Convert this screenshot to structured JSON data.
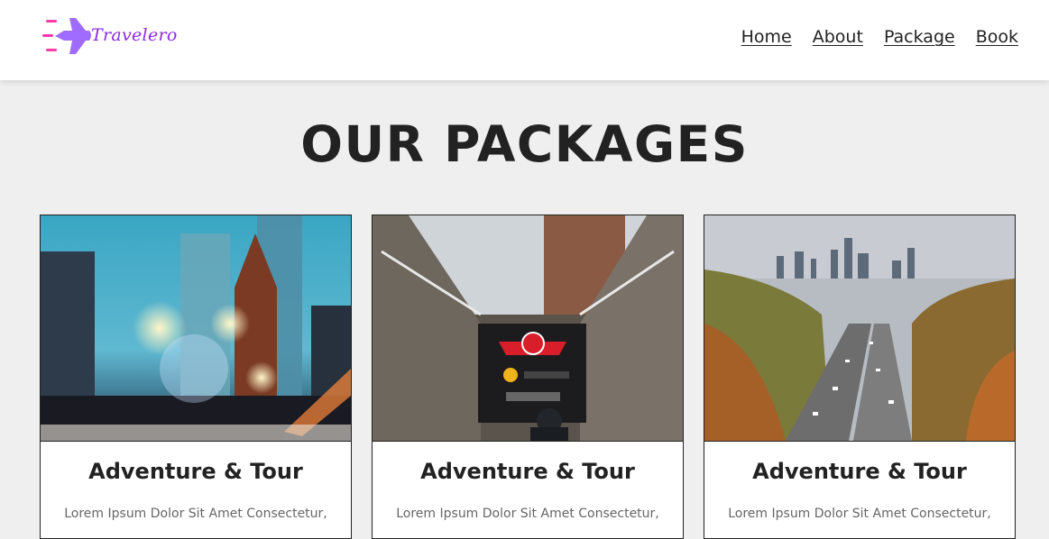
{
  "brand": {
    "name": "Travelero",
    "accent": "#8a2be2",
    "plane_color": "#a06bff",
    "stripe_color": "#ff3aa8"
  },
  "nav": {
    "items": [
      {
        "label": "Home"
      },
      {
        "label": "About"
      },
      {
        "label": "Package"
      },
      {
        "label": "Book"
      }
    ]
  },
  "main": {
    "title": "OUR PACKAGES",
    "cards": [
      {
        "image": "city-night-street-photo",
        "title": "Adventure & Tour",
        "text": "Lorem Ipsum Dolor Sit Amet Consectetur,"
      },
      {
        "image": "subway-entrance-photo",
        "title": "Adventure & Tour",
        "text": "Lorem Ipsum Dolor Sit Amet Consectetur,"
      },
      {
        "image": "highway-valley-skyline-photo",
        "title": "Adventure & Tour",
        "text": "Lorem Ipsum Dolor Sit Amet Consectetur,"
      }
    ]
  },
  "colors": {
    "background": "#efefef",
    "text": "#222222",
    "muted": "#666666"
  }
}
